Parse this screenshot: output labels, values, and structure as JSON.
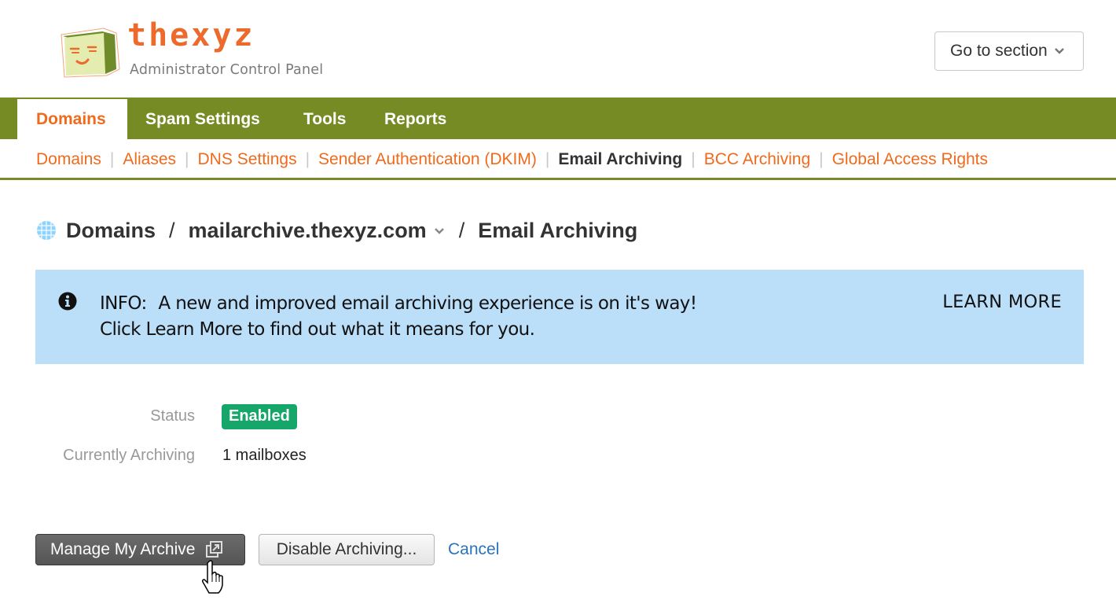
{
  "header": {
    "logo_name": "thexyz",
    "logo_subtitle": "Administrator Control Panel",
    "goto_section_label": "Go to section"
  },
  "main_nav": {
    "tabs": [
      {
        "label": "Domains",
        "active": true
      },
      {
        "label": "Spam Settings",
        "active": false
      },
      {
        "label": "Tools",
        "active": false
      },
      {
        "label": "Reports",
        "active": false
      }
    ]
  },
  "sub_nav": {
    "items": [
      {
        "label": "Domains",
        "current": false
      },
      {
        "label": "Aliases",
        "current": false
      },
      {
        "label": "DNS Settings",
        "current": false
      },
      {
        "label": "Sender Authentication (DKIM)",
        "current": false
      },
      {
        "label": "Email Archiving",
        "current": true
      },
      {
        "label": "BCC Archiving",
        "current": false
      },
      {
        "label": "Global Access Rights",
        "current": false
      }
    ],
    "separator": "|"
  },
  "breadcrumb": {
    "root": "Domains",
    "domain": "mailarchive.thexyz.com",
    "page": "Email Archiving",
    "separator": "/"
  },
  "banner": {
    "label": "INFO:",
    "line1": "A new and improved email archiving experience is on it's way!",
    "line2": "Click Learn More to find out what it means for you.",
    "learn_more": "LEARN MORE"
  },
  "details": {
    "status_label": "Status",
    "status_value": "Enabled",
    "archiving_label": "Currently Archiving",
    "archiving_value": "1 mailboxes"
  },
  "actions": {
    "manage_label": "Manage My Archive",
    "disable_label": "Disable Archiving...",
    "cancel_label": "Cancel"
  },
  "colors": {
    "brand_green": "#768b23",
    "brand_orange": "#f06a1c",
    "banner_blue": "#bbdef9",
    "status_green": "#16a66a",
    "link_blue": "#2a73bd"
  }
}
